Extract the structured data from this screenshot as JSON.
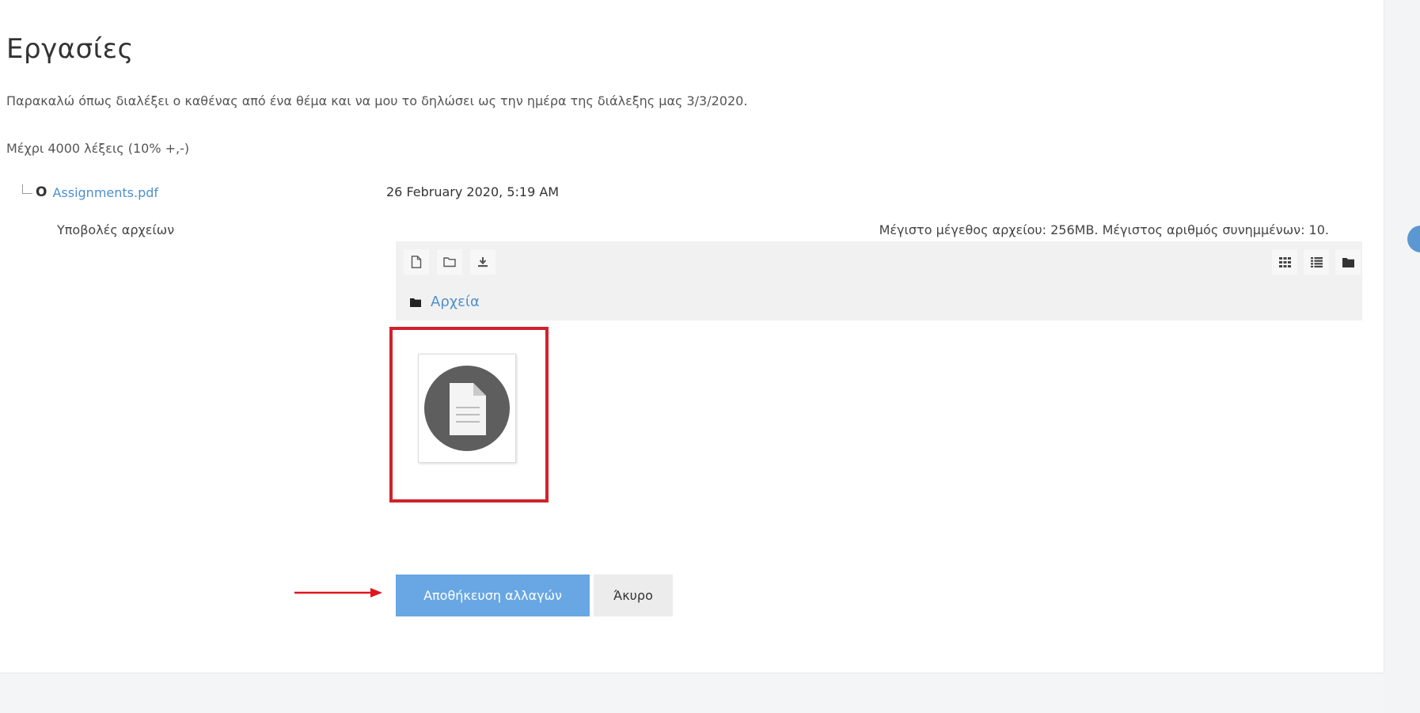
{
  "page": {
    "title": "Εργασίες",
    "intro": "Παρακαλώ όπως διαλέξει ο καθένας από ένα  θέμα και να μου το δηλώσει ως την ημέρα της διάλεξης μας 3/3/2020.",
    "word_limit": "Μέχρι 4000 λέξεις (10% +,-)"
  },
  "attachment": {
    "icon": "pdf-icon",
    "name": "Assignments.pdf",
    "date": "26 February 2020, 5:19 AM"
  },
  "submission": {
    "label": "Υποβολές αρχείων",
    "limits": "Μέγιστο μέγεθος αρχείου: 256MB. Μέγιστος αριθμός συνημμένων: 10."
  },
  "filemanager": {
    "toolbar_left": [
      "add-file-icon",
      "create-folder-icon",
      "download-icon"
    ],
    "toolbar_right": [
      "grid-view-icon",
      "list-view-icon",
      "tree-view-icon"
    ],
    "breadcrumb": "Αρχεία",
    "files": [
      {
        "icon": "document-icon"
      }
    ]
  },
  "actions": {
    "save_label": "Αποθήκευση αλλαγών",
    "cancel_label": "Άκυρο"
  },
  "colors": {
    "accent": "#68a7e3",
    "link": "#4e8fcf",
    "highlight": "#d0222c"
  }
}
